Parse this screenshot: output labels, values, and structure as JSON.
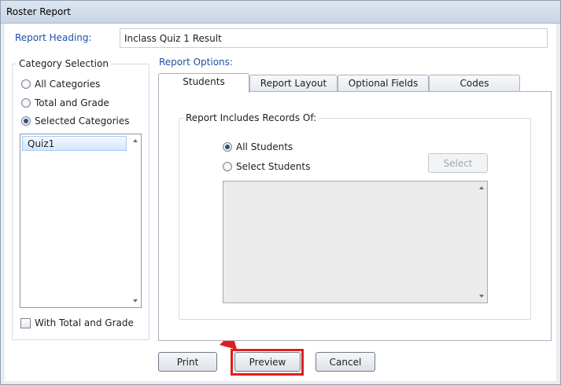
{
  "window": {
    "title": "Roster Report"
  },
  "report_heading": {
    "label": "Report Heading:",
    "value": "Inclass Quiz 1 Result"
  },
  "category_selection": {
    "title": "Category Selection",
    "options": [
      {
        "label": "All Categories",
        "checked": false
      },
      {
        "label": "Total and Grade",
        "checked": false
      },
      {
        "label": "Selected Categories",
        "checked": true
      }
    ],
    "list_items": [
      "Quiz1"
    ],
    "with_total_label": "With Total and Grade"
  },
  "report_options": {
    "label": "Report Options:",
    "tabs": [
      "Students",
      "Report Layout",
      "Optional Fields",
      "Codes"
    ],
    "active_tab": "Students",
    "group_title": "Report Includes Records Of:",
    "radio_all": "All Students",
    "radio_select": "Select Students",
    "select_button": "Select"
  },
  "buttons": {
    "print": "Print",
    "preview": "Preview",
    "cancel": "Cancel"
  },
  "colors": {
    "accent_label": "#1f4fa5",
    "annotation": "#e21d1d"
  }
}
